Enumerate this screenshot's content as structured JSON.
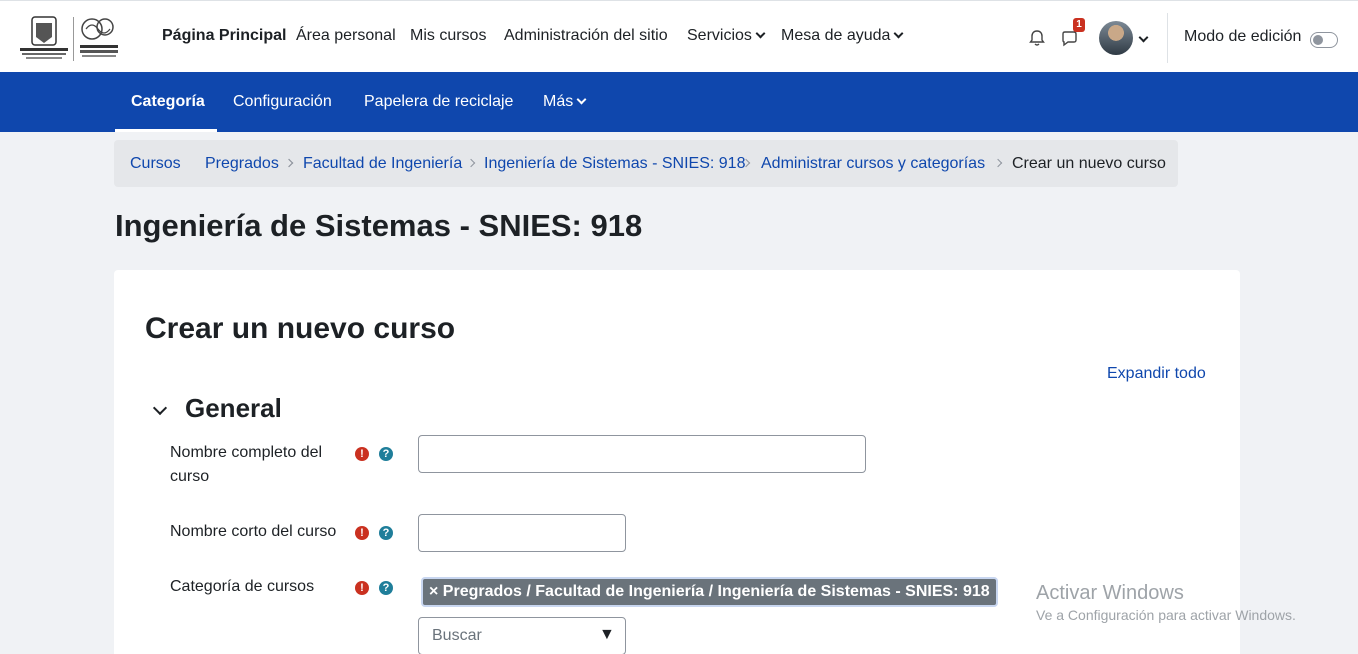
{
  "topnav": {
    "links": [
      "Página Principal",
      "Área personal",
      "Mis cursos",
      "Administración del sitio",
      "Servicios",
      "Mesa de ayuda"
    ],
    "notification_count": "1",
    "edit_mode_label": "Modo de edición"
  },
  "secondary_nav": {
    "items": [
      "Categoría",
      "Configuración",
      "Papelera de reciclaje",
      "Más"
    ]
  },
  "breadcrumb": [
    "Cursos",
    "Pregrados",
    "Facultad de Ingeniería",
    "Ingeniería de Sistemas - SNIES: 918",
    "Administrar cursos y categorías",
    "Crear un nuevo curso"
  ],
  "page_title": "Ingeniería de Sistemas - SNIES: 918",
  "form": {
    "title": "Crear un nuevo curso",
    "expand_all": "Expandir todo",
    "section_title": "General",
    "fields": {
      "fullname_label": "Nombre completo del curso",
      "fullname_value": "",
      "shortname_label": "Nombre corto del curso",
      "shortname_value": "",
      "category_label": "Categoría de cursos",
      "category_selected": "× Pregrados / Facultad de Ingeniería / Ingeniería de Sistemas - SNIES: 918",
      "category_search_placeholder": "Buscar"
    }
  },
  "watermark": {
    "line1": "Activar Windows",
    "line2": "Ve a Configuración para activar Windows."
  },
  "colors": {
    "primary": "#0f47ad",
    "required": "#ca3120",
    "help": "#1f7e9a",
    "page_bg": "#f0f2f5"
  },
  "icons": [
    "university-logo",
    "pantic-logo",
    "bell-icon",
    "chat-icon",
    "avatar",
    "required-icon",
    "help-icon",
    "dropdown-arrow-icon"
  ]
}
